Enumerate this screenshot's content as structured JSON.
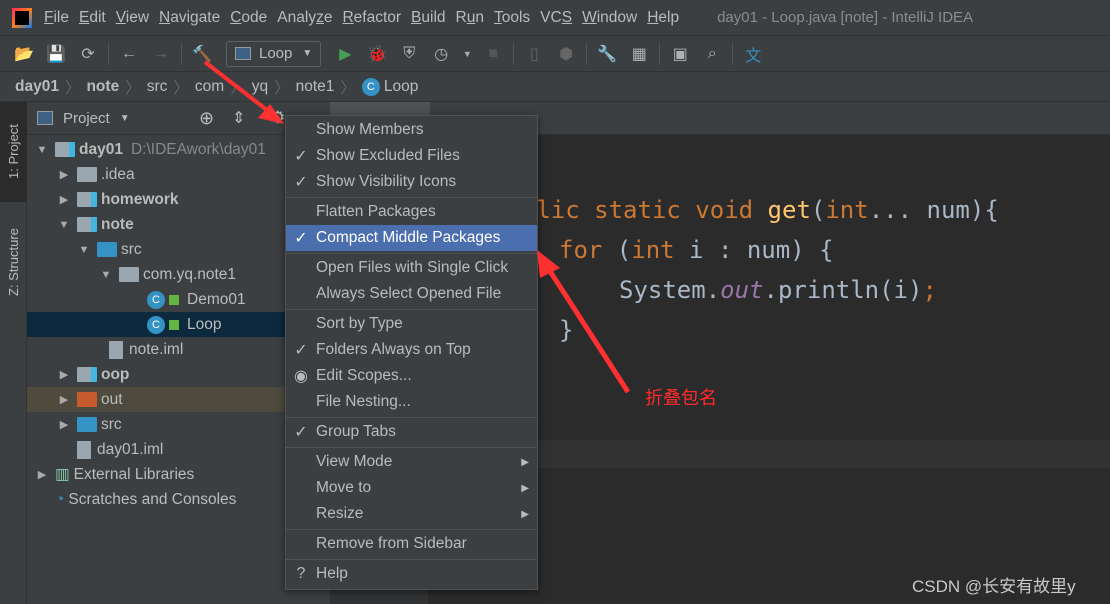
{
  "window": {
    "title": "day01 - Loop.java [note] - IntelliJ IDEA"
  },
  "menu": [
    {
      "u": "F",
      "rest": "ile"
    },
    {
      "u": "E",
      "rest": "dit"
    },
    {
      "u": "V",
      "rest": "iew"
    },
    {
      "u": "N",
      "rest": "avigate"
    },
    {
      "u": "C",
      "rest": "ode"
    },
    {
      "pre": "Analy",
      "u": "z",
      "rest": "e"
    },
    {
      "u": "R",
      "rest": "efactor"
    },
    {
      "u": "B",
      "rest": "uild"
    },
    {
      "pre": "R",
      "u": "u",
      "rest": "n"
    },
    {
      "u": "T",
      "rest": "ools"
    },
    {
      "pre": "VC",
      "u": "S",
      "rest": ""
    },
    {
      "u": "W",
      "rest": "indow"
    },
    {
      "u": "H",
      "rest": "elp"
    }
  ],
  "toolbar": {
    "run_config": "Loop"
  },
  "breadcrumb": [
    "day01",
    "note",
    "src",
    "com",
    "yq",
    "note1",
    "Loop"
  ],
  "stripe": {
    "project": "1: Project",
    "structure": "Z: Structure"
  },
  "panel": {
    "title": "Project"
  },
  "tree": [
    {
      "label": "day01",
      "extra": "D:\\IDEAwork\\day01",
      "bold": true
    },
    {
      "label": ".idea"
    },
    {
      "label": "homework",
      "bold": true
    },
    {
      "label": "note",
      "bold": true
    },
    {
      "label": "src"
    },
    {
      "label": "com.yq.note1"
    },
    {
      "label": "Demo01"
    },
    {
      "label": "Loop",
      "selected": true
    },
    {
      "label": "note.iml"
    },
    {
      "label": "oop",
      "bold": true
    },
    {
      "label": "out"
    },
    {
      "label": "src"
    },
    {
      "label": "day01.iml"
    },
    {
      "label": "External Libraries"
    },
    {
      "label": "Scratches and Consoles"
    }
  ],
  "code": {
    "l1": {
      "a": "public static void ",
      "b": "get",
      "c": "(",
      "d": "int",
      "e": "... num){"
    },
    "l2": {
      "a": "for ",
      "b": "(",
      "c": "int",
      "d": " i : num) {"
    },
    "l3": {
      "a": "System.",
      "b": "out",
      "c": ".println(i)",
      "d": ";"
    },
    "l4": "}"
  },
  "context_menu": [
    {
      "label": "Show Members",
      "mark": ""
    },
    {
      "label": "Show Excluded Files",
      "mark": "✓"
    },
    {
      "label": "Show Visibility Icons",
      "mark": "✓"
    },
    {
      "label": "Flatten Packages",
      "mark": ""
    },
    {
      "label": "Compact Middle Packages",
      "mark": "✓",
      "highlighted": true
    },
    {
      "label": "Open Files with Single Click",
      "mark": ""
    },
    {
      "label": "Always Select Opened File",
      "mark": ""
    },
    {
      "label": "Sort by Type",
      "mark": ""
    },
    {
      "label": "Folders Always on Top",
      "mark": "✓"
    },
    {
      "label": "Edit Scopes...",
      "mark": "◉"
    },
    {
      "label": "File Nesting...",
      "mark": ""
    },
    {
      "label": "Group Tabs",
      "mark": "✓"
    },
    {
      "label": "View Mode",
      "mark": "",
      "submenu": true
    },
    {
      "label": "Move to",
      "mark": "",
      "submenu": true
    },
    {
      "label": "Resize",
      "mark": "",
      "submenu": true
    },
    {
      "label": "Remove from Sidebar",
      "mark": ""
    },
    {
      "label": "Help",
      "mark": "?"
    }
  ],
  "annotation": "折叠包名",
  "watermark": "CSDN @长安有故里y",
  "colors": {
    "accent": "#4b6eaf",
    "annotation": "#ff2b2b",
    "keyword": "#cc7832",
    "function": "#ffc66d"
  }
}
